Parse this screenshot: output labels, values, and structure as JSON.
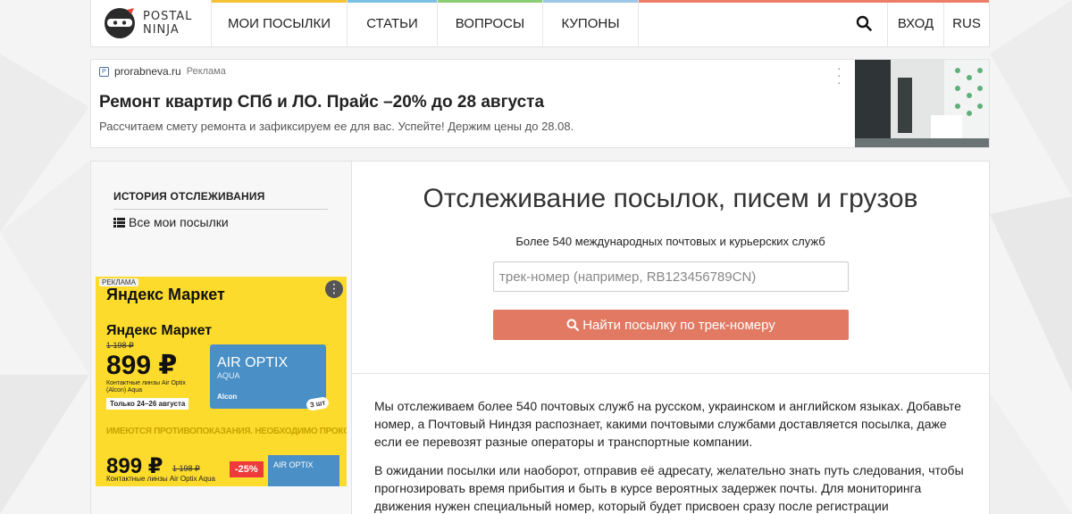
{
  "header": {
    "logo_line1": "POSTAL",
    "logo_line2": "NINJA",
    "nav": [
      {
        "label": "МОИ ПОСЫЛКИ",
        "accent": "#f5c236"
      },
      {
        "label": "СТАТЬИ",
        "accent": "#7bc0e6"
      },
      {
        "label": "ВОПРОСЫ",
        "accent": "#8ccf73"
      },
      {
        "label": "КУПОНЫ",
        "accent": "#9ec6e8"
      }
    ],
    "search_icon": "search-icon",
    "login_label": "ВХОД",
    "lang_label": "RUS",
    "accent_color": "#ec7e67"
  },
  "ad_banner": {
    "domain": "prorabneva.ru",
    "ad_label": "Реклама",
    "title": "Ремонт квартир СПб и ЛО. Прайс –20% до 28 августа",
    "description": "Рассчитаем смету ремонта и зафиксируем ее для вас. Успейте! Держим цены до 28.08."
  },
  "sidebar": {
    "history_title": "ИСТОРИЯ ОТСЛЕЖИВАНИЯ",
    "all_parcels_link": "Все мои посылки"
  },
  "sidebar_ad": {
    "label": "РЕКЛАМА",
    "brand": "Яндекс Маркет",
    "old_price": "1 198 ₽",
    "price": "899 ₽",
    "product": "Контактные линзы Air Optix (Alcon) Aqua",
    "dates": "Только 24–26 августа",
    "warning": "ИМЕЮТСЯ ПРОТИВОПОКАЗАНИЯ. НЕОБХОДИМО ПРОКОНСУЛЬТИРОВАТЬСЯ СО СПЕЦИАЛИСТОМ",
    "box_title": "AIR OPTIX",
    "box_sub": "AQUA",
    "box_brand": "Alcon",
    "pack": "3 шт",
    "discount": "-25%",
    "product2": "Контактные линзы Air Optix Aqua",
    "box2_title": "AIR OPTIX",
    "accent": "#fcdb2c"
  },
  "main": {
    "title": "Отслеживание посылок, писем и грузов",
    "subtitle": "Более 540 международных почтовых и курьерских служб",
    "input_placeholder": "трек-номер (например, RB123456789CN)",
    "button_label": "Найти посылку по трек-номеру",
    "button_color": "#e27a63",
    "paragraph1": "Мы отслеживаем более 540 почтовых служб на русском, украинском и английском языках. Добавьте номер, а Почтовый Ниндзя распознает, какими почтовыми службами доставляется посылка, даже если ее перевозят разные операторы и транспортные компании.",
    "paragraph2": "В ожидании посылки или наоборот, отправив её адресату, желательно знать путь следования, чтобы прогнозировать время прибытия и быть в курсе вероятных задержек почты. Для мониторинга движения нужен специальный номер, который будет присвоен сразу после регистрации отправления в"
  }
}
